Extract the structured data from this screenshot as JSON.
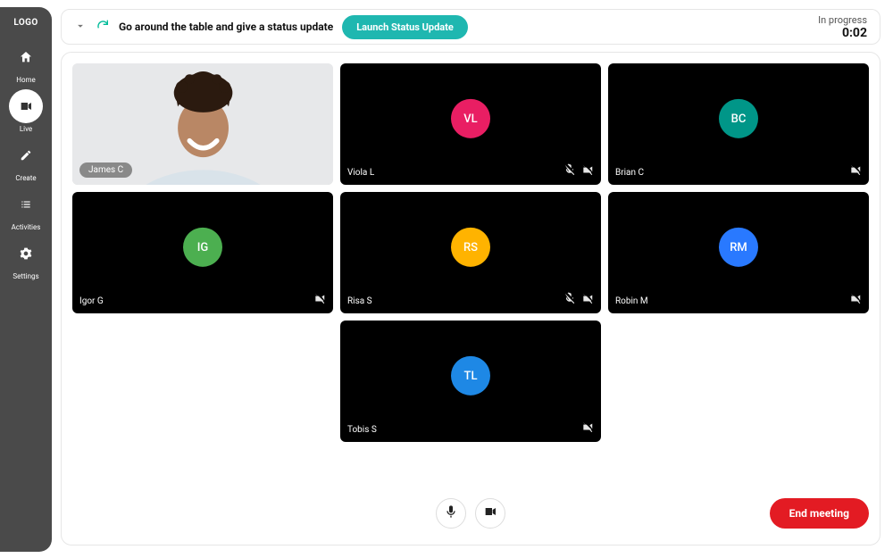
{
  "brand": "LOGO",
  "nav": {
    "items": [
      {
        "id": "home",
        "label": "Home",
        "active": false
      },
      {
        "id": "live",
        "label": "Live",
        "active": true
      },
      {
        "id": "create",
        "label": "Create",
        "active": false
      },
      {
        "id": "activities",
        "label": "Activities",
        "active": false
      },
      {
        "id": "settings",
        "label": "Settings",
        "active": false
      }
    ]
  },
  "topbar": {
    "prompt": "Go around the table and give a status update",
    "launch_label": "Launch Status Update",
    "status": "In progress",
    "timer": "0:02"
  },
  "participants": [
    {
      "name": "James C",
      "initials": "",
      "color": "",
      "has_video": true,
      "muted": false,
      "camera_off": false
    },
    {
      "name": "Viola L",
      "initials": "VL",
      "color": "#e91e63",
      "has_video": false,
      "muted": true,
      "camera_off": true
    },
    {
      "name": "Brian C",
      "initials": "BC",
      "color": "#009688",
      "has_video": false,
      "muted": false,
      "camera_off": true
    },
    {
      "name": "Igor G",
      "initials": "IG",
      "color": "#4caf50",
      "has_video": false,
      "muted": false,
      "camera_off": true
    },
    {
      "name": "Risa S",
      "initials": "RS",
      "color": "#ffb300",
      "has_video": false,
      "muted": true,
      "camera_off": true
    },
    {
      "name": "Robin M",
      "initials": "RM",
      "color": "#2979ff",
      "has_video": false,
      "muted": false,
      "camera_off": true
    },
    {
      "name": "Tobis S",
      "initials": "TL",
      "color": "#1e88e5",
      "has_video": false,
      "muted": false,
      "camera_off": true
    }
  ],
  "footer": {
    "end_label": "End meeting"
  }
}
